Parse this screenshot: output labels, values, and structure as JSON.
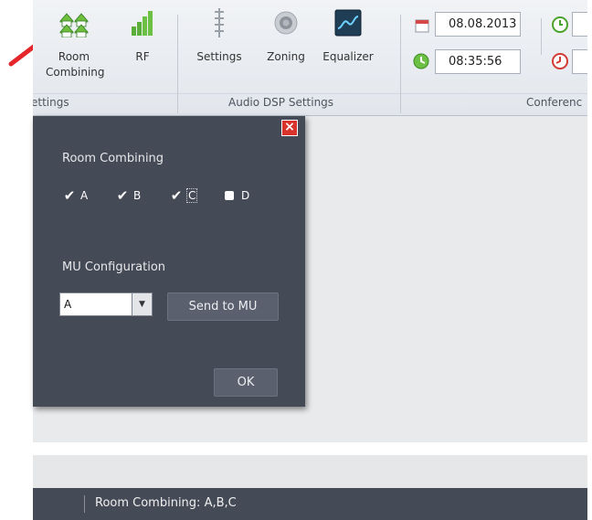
{
  "ribbon": {
    "groups": {
      "settings_left": "ettings",
      "audio_dsp": "Audio DSP Settings",
      "conference": "Conferenc"
    },
    "buttons": {
      "room_combining": "Room Combining",
      "rf": "RF",
      "settings": "Settings",
      "zoning": "Zoning",
      "equalizer": "Equalizer"
    },
    "date_value": "08.08.2013",
    "time_value": "08:35:56"
  },
  "dialog": {
    "close_symbol": "×",
    "room_combining_label": "Room Combining",
    "checkboxes": [
      {
        "label": "A",
        "checked": true
      },
      {
        "label": "B",
        "checked": true
      },
      {
        "label": "C",
        "checked": true
      },
      {
        "label": "D",
        "checked": false
      }
    ],
    "mu_configuration_label": "MU Configuration",
    "mu_select_value": "A",
    "send_button": "Send to MU",
    "ok_button": "OK"
  },
  "status": {
    "text": "Room Combining: A,B,C"
  },
  "colors": {
    "dialog_bg": "#454a57",
    "close_red": "#d8342c",
    "arrow_red": "#e5262a",
    "icon_green": "#5cae3a"
  }
}
